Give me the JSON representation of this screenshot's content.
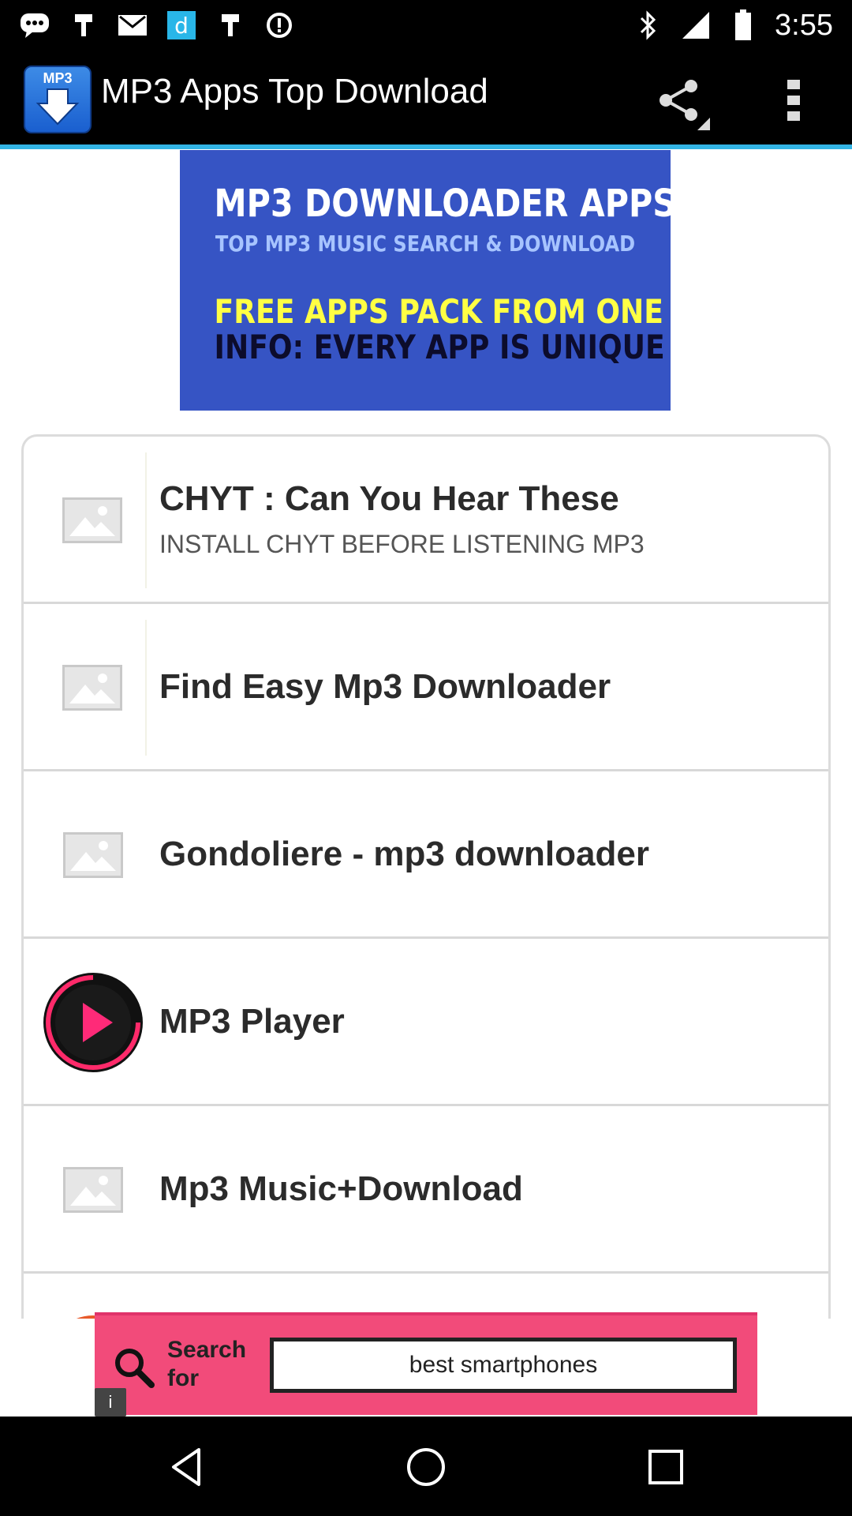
{
  "status_bar": {
    "time": "3:55",
    "left_icons": [
      "messenger-icon",
      "notification-icon",
      "mail-icon",
      "dictionary-icon",
      "notification-icon",
      "sync-icon"
    ],
    "right_icons": [
      "bluetooth-icon",
      "signal-icon",
      "battery-icon"
    ]
  },
  "header": {
    "app_icon_text": "MP3",
    "title": "MP3 Apps Top Download",
    "share_icon": "share-icon",
    "overflow_icon": "more-vert-icon"
  },
  "banner": {
    "line1": "MP3 DOWNLOADER APPS",
    "line2": "TOP MP3 MUSIC SEARCH & DOWNLOAD",
    "line3": "FREE APPS PACK FROM ONE",
    "line4": "INFO: EVERY APP IS UNIQUE",
    "colors": {
      "background": "#3654c4",
      "line3": "#ffff44",
      "line4": "#0c0c2c"
    }
  },
  "list": {
    "items": [
      {
        "title": "CHYT : Can You Hear These",
        "subtitle": "INSTALL CHYT BEFORE LISTENING MP3",
        "icon": "image-placeholder-icon"
      },
      {
        "title": "Find Easy Mp3 Downloader",
        "subtitle": "",
        "icon": "image-placeholder-icon"
      },
      {
        "title": "Gondoliere - mp3 downloader",
        "subtitle": "",
        "icon": "image-placeholder-icon"
      },
      {
        "title": "MP3 Player",
        "subtitle": "",
        "icon": "play-icon"
      },
      {
        "title": "Mp3 Music+Download",
        "subtitle": "",
        "icon": "image-placeholder-icon"
      }
    ]
  },
  "ad": {
    "label": "Search for",
    "query": "best smartphones",
    "info": "i",
    "colors": {
      "background": "#f24b7a"
    }
  },
  "nav_bar": {
    "buttons": [
      "back-icon",
      "home-icon",
      "recents-icon"
    ]
  },
  "colors": {
    "accent": "#33b5e5",
    "action_bar": "#000000"
  }
}
